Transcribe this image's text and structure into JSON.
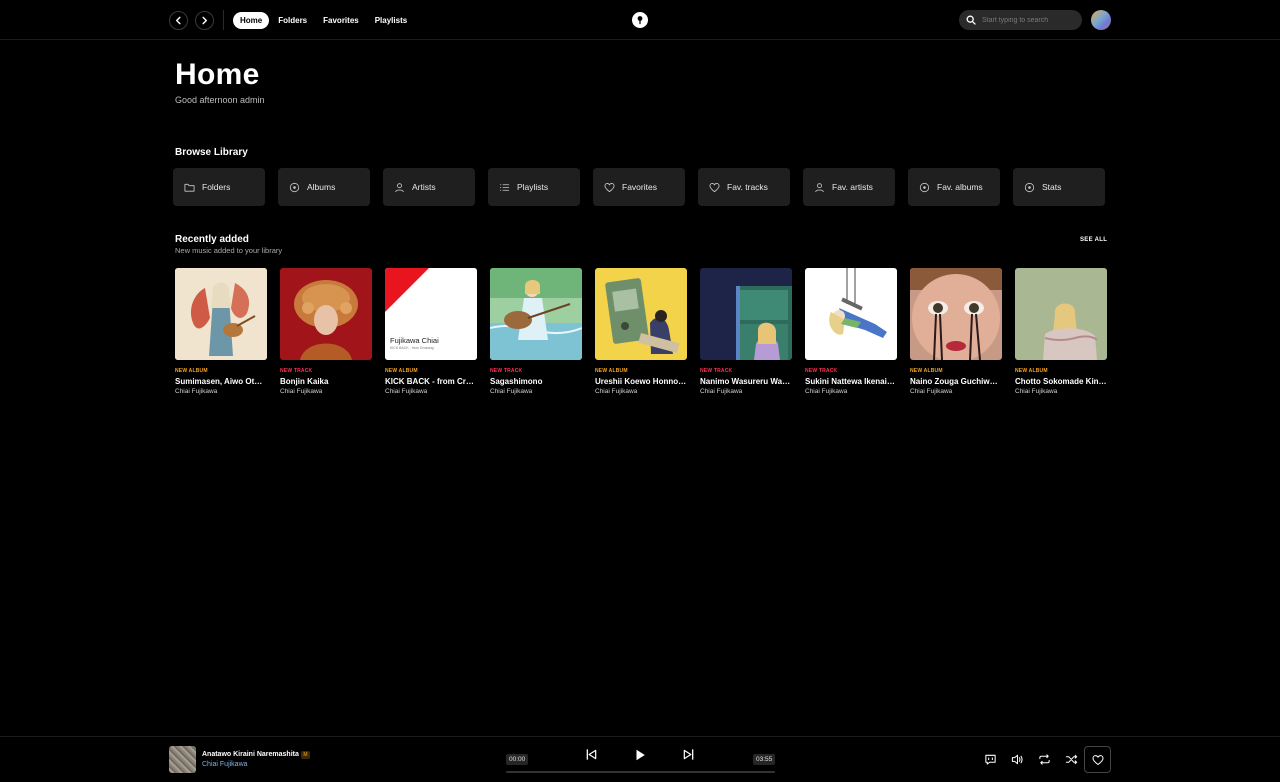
{
  "topbar": {
    "nav": [
      {
        "label": "Home",
        "active": true
      },
      {
        "label": "Folders",
        "active": false
      },
      {
        "label": "Favorites",
        "active": false
      },
      {
        "label": "Playlists",
        "active": false
      }
    ],
    "search_placeholder": "Start typing to search"
  },
  "header": {
    "title": "Home",
    "greeting": "Good afternoon admin"
  },
  "browse": {
    "title": "Browse Library",
    "tiles": [
      {
        "label": "Folders",
        "icon": "folder-icon"
      },
      {
        "label": "Albums",
        "icon": "disc-icon"
      },
      {
        "label": "Artists",
        "icon": "person-icon"
      },
      {
        "label": "Playlists",
        "icon": "list-icon"
      },
      {
        "label": "Favorites",
        "icon": "heart-icon"
      },
      {
        "label": "Fav. tracks",
        "icon": "heart-icon"
      },
      {
        "label": "Fav. artists",
        "icon": "person-icon"
      },
      {
        "label": "Fav. albums",
        "icon": "disc-icon"
      },
      {
        "label": "Stats",
        "icon": "disc-icon"
      }
    ]
  },
  "recent": {
    "title": "Recently added",
    "subtitle": "New music added to your library",
    "see_all": "SEE ALL",
    "items": [
      {
        "badge": "NEW ALBUM",
        "type": "album",
        "title": "Sumimasen, Aiwo Oto…",
        "artist": "Chiai Fujikawa"
      },
      {
        "badge": "NEW TRACK",
        "type": "track",
        "title": "Bonjin Kaika",
        "artist": "Chiai Fujikawa"
      },
      {
        "badge": "NEW ALBUM",
        "type": "album",
        "title": "KICK BACK - from Cro…",
        "artist": "Chiai Fujikawa",
        "cover_text_1": "Fujikawa Chiai",
        "cover_text_2": "KICK BACK - from Crossing"
      },
      {
        "badge": "NEW TRACK",
        "type": "track",
        "title": "Sagashimono",
        "artist": "Chiai Fujikawa"
      },
      {
        "badge": "NEW ALBUM",
        "type": "album",
        "title": "Ureshii Koewo Honno…",
        "artist": "Chiai Fujikawa"
      },
      {
        "badge": "NEW TRACK",
        "type": "track",
        "title": "Nanimo Wasureru Wak…",
        "artist": "Chiai Fujikawa"
      },
      {
        "badge": "NEW TRACK",
        "type": "track",
        "title": "Sukini Nattewa Ikenai …",
        "artist": "Chiai Fujikawa"
      },
      {
        "badge": "NEW ALBUM",
        "type": "album",
        "title": "Naino Zouga Guchiwo…",
        "artist": "Chiai Fujikawa"
      },
      {
        "badge": "NEW ALBUM",
        "type": "album",
        "title": "Chotto Sokomade Kin…",
        "artist": "Chiai Fujikawa"
      }
    ]
  },
  "player": {
    "title": "Anatawo Kiraini Naremashita",
    "explicit_badge": "M",
    "artist": "Chiai Fujikawa",
    "current_time": "00:00",
    "duration": "03:55",
    "progress": 0
  },
  "colors": {
    "accent_album": "#f5a623",
    "accent_track": "#ff3355",
    "artist_link": "#7fb3e6"
  }
}
